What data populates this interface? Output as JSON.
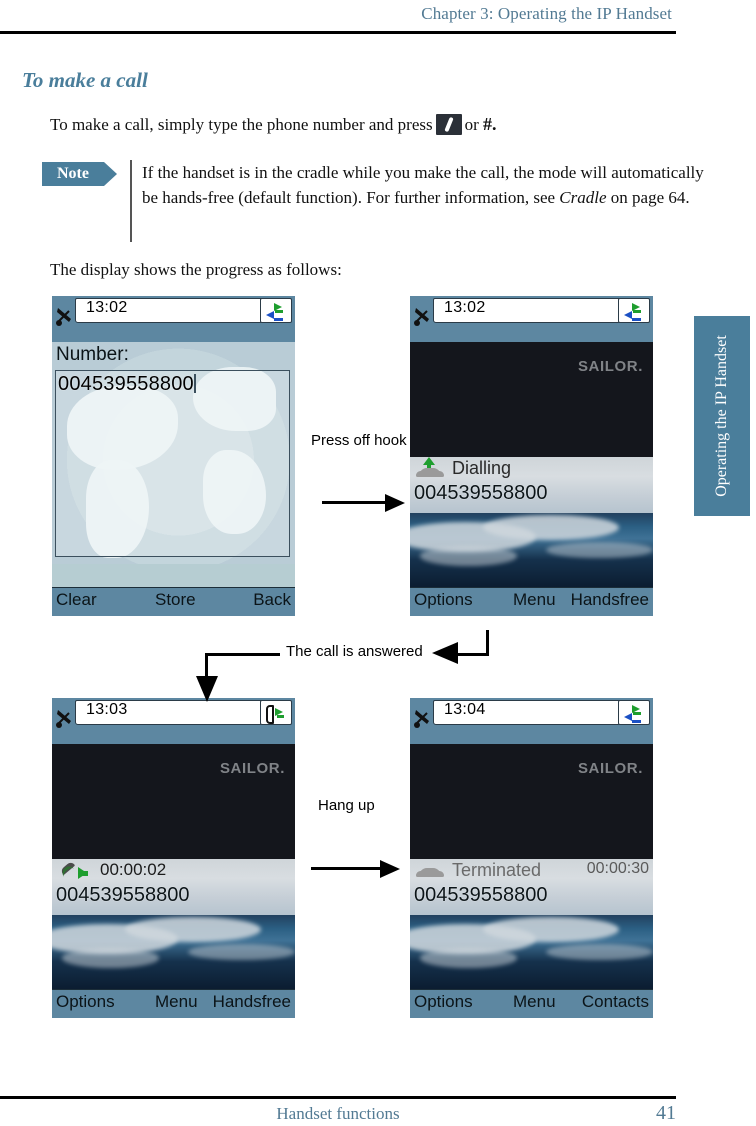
{
  "header": {
    "chapter_title": "Chapter 3:  Operating the IP Handset"
  },
  "section": {
    "title": "To make a call"
  },
  "paragraphs": {
    "intro_before_key": "To make a call, simply type the phone number and press",
    "intro_or": "or",
    "intro_hash": "#.",
    "display_progress": "The display shows the progress as follows:"
  },
  "note": {
    "tag": "Note",
    "text_line1": "If the handset is in the cradle while you make the call, the mode will",
    "text_line2": "automatically be hands-free (default function). For further",
    "text_line3_before": "information, see ",
    "text_line3_italic": "Cradle",
    "text_line3_after": " on page 64."
  },
  "side_tab": {
    "label": "Operating the IP Handset"
  },
  "screens": {
    "number_entry": {
      "time": "13:02",
      "field_label": "Number:",
      "field_value": "004539558800",
      "softkey_left": "Clear",
      "softkey_middle": "Store",
      "softkey_right": "Back"
    },
    "dialling": {
      "time": "13:02",
      "brand": "SAILOR.",
      "state": "Dialling",
      "number": "004539558800",
      "softkey_left": "Options",
      "softkey_middle": "Menu",
      "softkey_right": "Handsfree"
    },
    "in_call": {
      "time": "13:03",
      "brand": "SAILOR.",
      "duration": "00:00:02",
      "number": "004539558800",
      "softkey_left": "Options",
      "softkey_middle": "Menu",
      "softkey_right": "Handsfree"
    },
    "terminated": {
      "time": "13:04",
      "brand": "SAILOR.",
      "state": "Terminated",
      "duration": "00:00:30",
      "number": "004539558800",
      "softkey_left": "Options",
      "softkey_middle": "Menu",
      "softkey_right": "Contacts"
    }
  },
  "annotations": {
    "press_off_hook": "Press off hook",
    "call_answered": "The call is answered",
    "hang_up": "Hang up"
  },
  "footer": {
    "section_name": "Handset functions",
    "page_number": "41"
  },
  "colors": {
    "accent_blue": "#4a7e9b",
    "header_text": "#527a93",
    "screen_chrome": "#5d87a1",
    "screen_dark": "#14161c",
    "green": "#1e9e2e",
    "blue_arrow": "#1b50c4"
  }
}
